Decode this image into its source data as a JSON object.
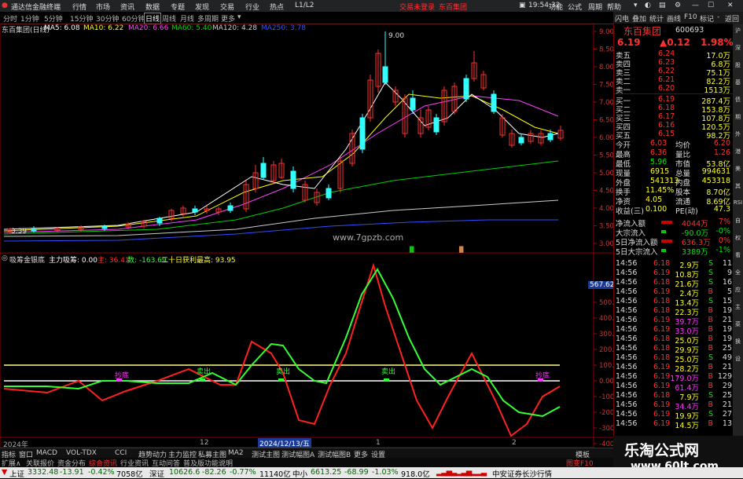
{
  "titlebar": {
    "app_title": "通达信金融终端",
    "menus": [
      "行情",
      "市场",
      "资讯",
      "数据",
      "专题",
      "发现",
      "交易",
      "行业",
      "热点",
      "L1/L2"
    ],
    "center_links": [
      "交易未登录",
      "东百集团"
    ],
    "time": "19:54:32",
    "right_menus": [
      "功能",
      "公式",
      "周期",
      "帮助"
    ]
  },
  "periodbar": {
    "items": [
      "分时",
      "1分钟",
      "5分钟",
      "15分钟",
      "30分钟",
      "60分钟",
      "日线",
      "周线",
      "月线",
      "多周期",
      "更多"
    ],
    "active": "日线"
  },
  "rtool": {
    "items": [
      "闪电",
      "叠加",
      "统计",
      "画线",
      "F10",
      "标记",
      "-",
      "返回"
    ]
  },
  "chart_header": {
    "name": "东百集团(日线)",
    "ma5": "MA5: 6.08",
    "ma10": "MA10: 6.22",
    "ma20": "MA20: 6.66",
    "ma60": "MA60: 5.40",
    "ma120": "MA120: 4.28",
    "ma250": "MA250: 3.78"
  },
  "price_axis": [
    "9.00",
    "8.50",
    "8.00",
    "7.50",
    "7.00",
    "6.50",
    "6.00",
    "5.50",
    "5.00",
    "4.50",
    "4.00",
    "3.50",
    "3.00"
  ],
  "high_label": "9.00",
  "low_label": "3.39",
  "chart_watermark": "www.7gpzb.com",
  "indicator_header": {
    "name": "吸筹金银底",
    "main": "主力吸筹: 0.00",
    "zhu": "主: 36.41",
    "shu": "数: -163.69",
    "high": "二十日获利最高: 93.95"
  },
  "indicator_axis": [
    "500.00",
    "400.00",
    "300.00",
    "200.00",
    "100.00",
    "0.00",
    "-100",
    "-200",
    "-300",
    "-400"
  ],
  "indicator_current": "567.62",
  "signals": [
    "抄底",
    "卖出",
    "卖出",
    "卖出",
    "抄底"
  ],
  "date_axis": {
    "year": "2024年",
    "m12": "12",
    "cursor": "2024/12/13/五",
    "m1": "1",
    "m2": "2"
  },
  "stock": {
    "name": "东百集团",
    "code": "600693",
    "price": "6.19",
    "change": "▲0.12",
    "pct": "1.98%"
  },
  "asks": [
    {
      "label": "卖五",
      "price": "6.24",
      "vol": "17.0万"
    },
    {
      "label": "卖四",
      "price": "6.23",
      "vol": "6.8万"
    },
    {
      "label": "卖三",
      "price": "6.22",
      "vol": "75.1万"
    },
    {
      "label": "卖二",
      "price": "6.21",
      "vol": "82.2万"
    },
    {
      "label": "卖一",
      "price": "6.20",
      "vol": "1513万"
    }
  ],
  "bids": [
    {
      "label": "买一",
      "price": "6.19",
      "vol": "287.4万"
    },
    {
      "label": "买二",
      "price": "6.18",
      "vol": "153.8万"
    },
    {
      "label": "买三",
      "price": "6.17",
      "vol": "107.8万"
    },
    {
      "label": "买四",
      "price": "6.16",
      "vol": "120.5万"
    },
    {
      "label": "买五",
      "price": "6.15",
      "vol": "98.2万"
    }
  ],
  "quote": [
    {
      "l1": "今开",
      "v1": "6.03",
      "l2": "均价",
      "v2": "6.20"
    },
    {
      "l1": "最高",
      "v1": "6.36",
      "l2": "量比",
      "v2": "1.26"
    },
    {
      "l1": "最低",
      "v1": "5.96",
      "l2": "市值",
      "v2": "53.8亿"
    },
    {
      "l1": "现量",
      "v1": "6915",
      "l2": "总量",
      "v2": "994631"
    },
    {
      "l1": "外盘",
      "v1": "541313",
      "l2": "内盘",
      "v2": "453318"
    },
    {
      "l1": "换手",
      "v1": "11.45%",
      "l2": "股本",
      "v2": "8.70亿"
    },
    {
      "l1": "净资",
      "v1": "4.05",
      "l2": "流通",
      "v2": "8.69亿"
    },
    {
      "l1": "收益(三)",
      "v1": "0.100",
      "l2": "PE(动)",
      "v2": "47.3"
    }
  ],
  "flows": [
    {
      "label": "净流入额",
      "val": "4044万",
      "pct": "7%"
    },
    {
      "label": "大宗流入",
      "val": "-90.0万",
      "pct": "-0%"
    },
    {
      "label": "5日净流入额",
      "val": "636.3万",
      "pct": "0%"
    },
    {
      "label": "5日大宗流入",
      "val": "3389万",
      "pct": "-1%"
    }
  ],
  "ticks": [
    {
      "t": "14:56",
      "p": "6.18",
      "v": "2.9万",
      "d": "S",
      "n": "11"
    },
    {
      "t": "14:56",
      "p": "6.19",
      "v": "10.8万",
      "d": "S",
      "n": "9"
    },
    {
      "t": "14:56",
      "p": "6.18",
      "v": "21.6万",
      "d": "S",
      "n": "16"
    },
    {
      "t": "14:56",
      "p": "6.19",
      "v": "2.4万",
      "d": "B",
      "n": "5"
    },
    {
      "t": "14:56",
      "p": "6.18",
      "v": "13.4万",
      "d": "S",
      "n": "15"
    },
    {
      "t": "14:56",
      "p": "6.18",
      "v": "22.3万",
      "d": "B",
      "n": "19"
    },
    {
      "t": "14:56",
      "p": "6.19",
      "v": "39.7万",
      "d": "B",
      "n": "21"
    },
    {
      "t": "14:56",
      "p": "6.19",
      "v": "33.0万",
      "d": "B",
      "n": "19"
    },
    {
      "t": "14:56",
      "p": "6.18",
      "v": "25.0万",
      "d": "B",
      "n": "19"
    },
    {
      "t": "14:56",
      "p": "6.18",
      "v": "29.9万",
      "d": "B",
      "n": "25"
    },
    {
      "t": "14:56",
      "p": "6.18",
      "v": "25.0万",
      "d": "S",
      "n": "49"
    },
    {
      "t": "14:56",
      "p": "6.19",
      "v": "28.2万",
      "d": "B",
      "n": "21"
    },
    {
      "t": "14:56",
      "p": "6.19",
      "v": "179.0万",
      "d": "B",
      "n": "129"
    },
    {
      "t": "14:56",
      "p": "6.19",
      "v": "61.4万",
      "d": "B",
      "n": "29"
    },
    {
      "t": "14:56",
      "p": "6.18",
      "v": "7.9万",
      "d": "S",
      "n": "25"
    },
    {
      "t": "14:56",
      "p": "6.19",
      "v": "34.4万",
      "d": "B",
      "n": "21"
    },
    {
      "t": "14:56",
      "p": "6.19",
      "v": "19.9万",
      "d": "S",
      "n": "27"
    },
    {
      "t": "14:56",
      "p": "6.19",
      "v": "14.5万",
      "d": "B",
      "n": "13"
    }
  ],
  "side_icons": [
    "沪",
    "深",
    "股",
    "基",
    "债",
    "期",
    "外",
    "港",
    "美",
    "其",
    "RSI",
    "自",
    "权",
    "看",
    "全",
    "应",
    "主",
    "菜",
    "换",
    "设"
  ],
  "tabs": [
    "指标",
    "窗口",
    "MACD",
    "VOL-TDX",
    "CCI",
    "趋势动力",
    "主力监控",
    "私募主图",
    "MA2",
    "测试主图",
    "测试幅图A",
    "测试幅图B",
    "更多",
    "设置"
  ],
  "tabs_right": "模板",
  "tabs2": [
    "扩展∧",
    "关联报价",
    "资金分布",
    "综合资讯",
    "行业资讯",
    "互动问答",
    "普及版功能说明"
  ],
  "tabs2_right": "图变F10",
  "status": {
    "sh_label": "上证",
    "sh": "3332.48",
    "sh_chg": "-13.91",
    "sh_pct": "-0.42%",
    "sh_amt": "7058亿",
    "sz_label": "深证",
    "sz": "10626.6",
    "sz_chg": "-82.26",
    "sz_pct": "-0.77%",
    "sz_amt": "11140亿",
    "zx_label": "中小",
    "zx": "6613.25",
    "zx_chg": "-68.99",
    "zx_pct": "-1.03%",
    "zx_amt": "918.0亿",
    "broker": "中安证券长沙行情"
  },
  "watermark": {
    "title": "乐淘公式网",
    "url": "www.60lt.com"
  },
  "colors": {
    "up": "#ff3030",
    "down": "#33ffff",
    "ma5": "#ffffff",
    "ma10": "#ffff00",
    "ma20": "#ff40ff",
    "ma60": "#00d000",
    "ma120": "#cccccc",
    "ma250": "#3050ff"
  }
}
